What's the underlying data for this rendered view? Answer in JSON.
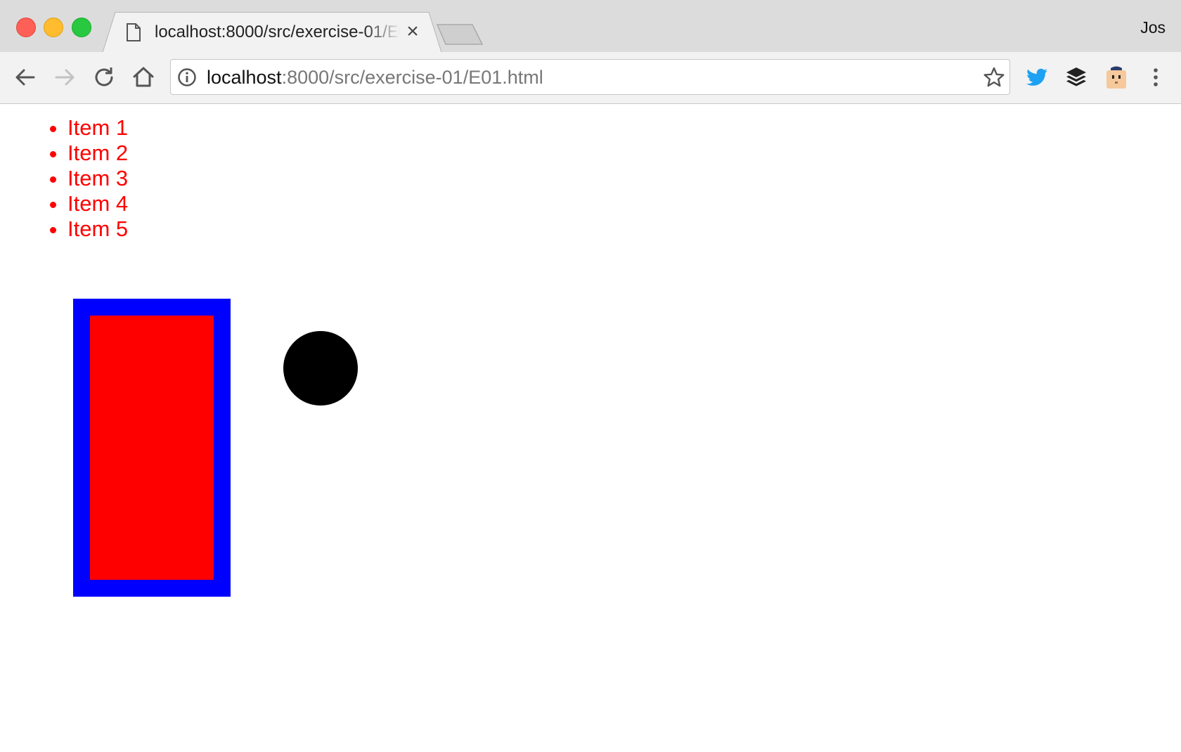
{
  "window": {
    "profile_name": "Jos"
  },
  "tab": {
    "title": "localhost:8000/src/exercise-01/E01.html",
    "close_label": "×"
  },
  "address_bar": {
    "url_host": "localhost",
    "url_path": ":8000/src/exercise-01/E01.html"
  },
  "toolbar": {
    "back_icon": "arrow-left-icon",
    "forward_icon": "arrow-right-icon",
    "reload_icon": "reload-icon",
    "home_icon": "home-icon",
    "bookmark_icon": "star-icon",
    "extensions": [
      "twitter-icon",
      "buffer-layers-icon",
      "face-extension-icon"
    ],
    "menu_icon": "three-dots-icon"
  },
  "page": {
    "items": [
      "Item 1",
      "Item 2",
      "Item 3",
      "Item 4",
      "Item 5"
    ],
    "colors": {
      "list_text": "#ff0000",
      "outer_box": "#0000ff",
      "inner_box": "#ff0000",
      "circle": "#000000"
    }
  }
}
